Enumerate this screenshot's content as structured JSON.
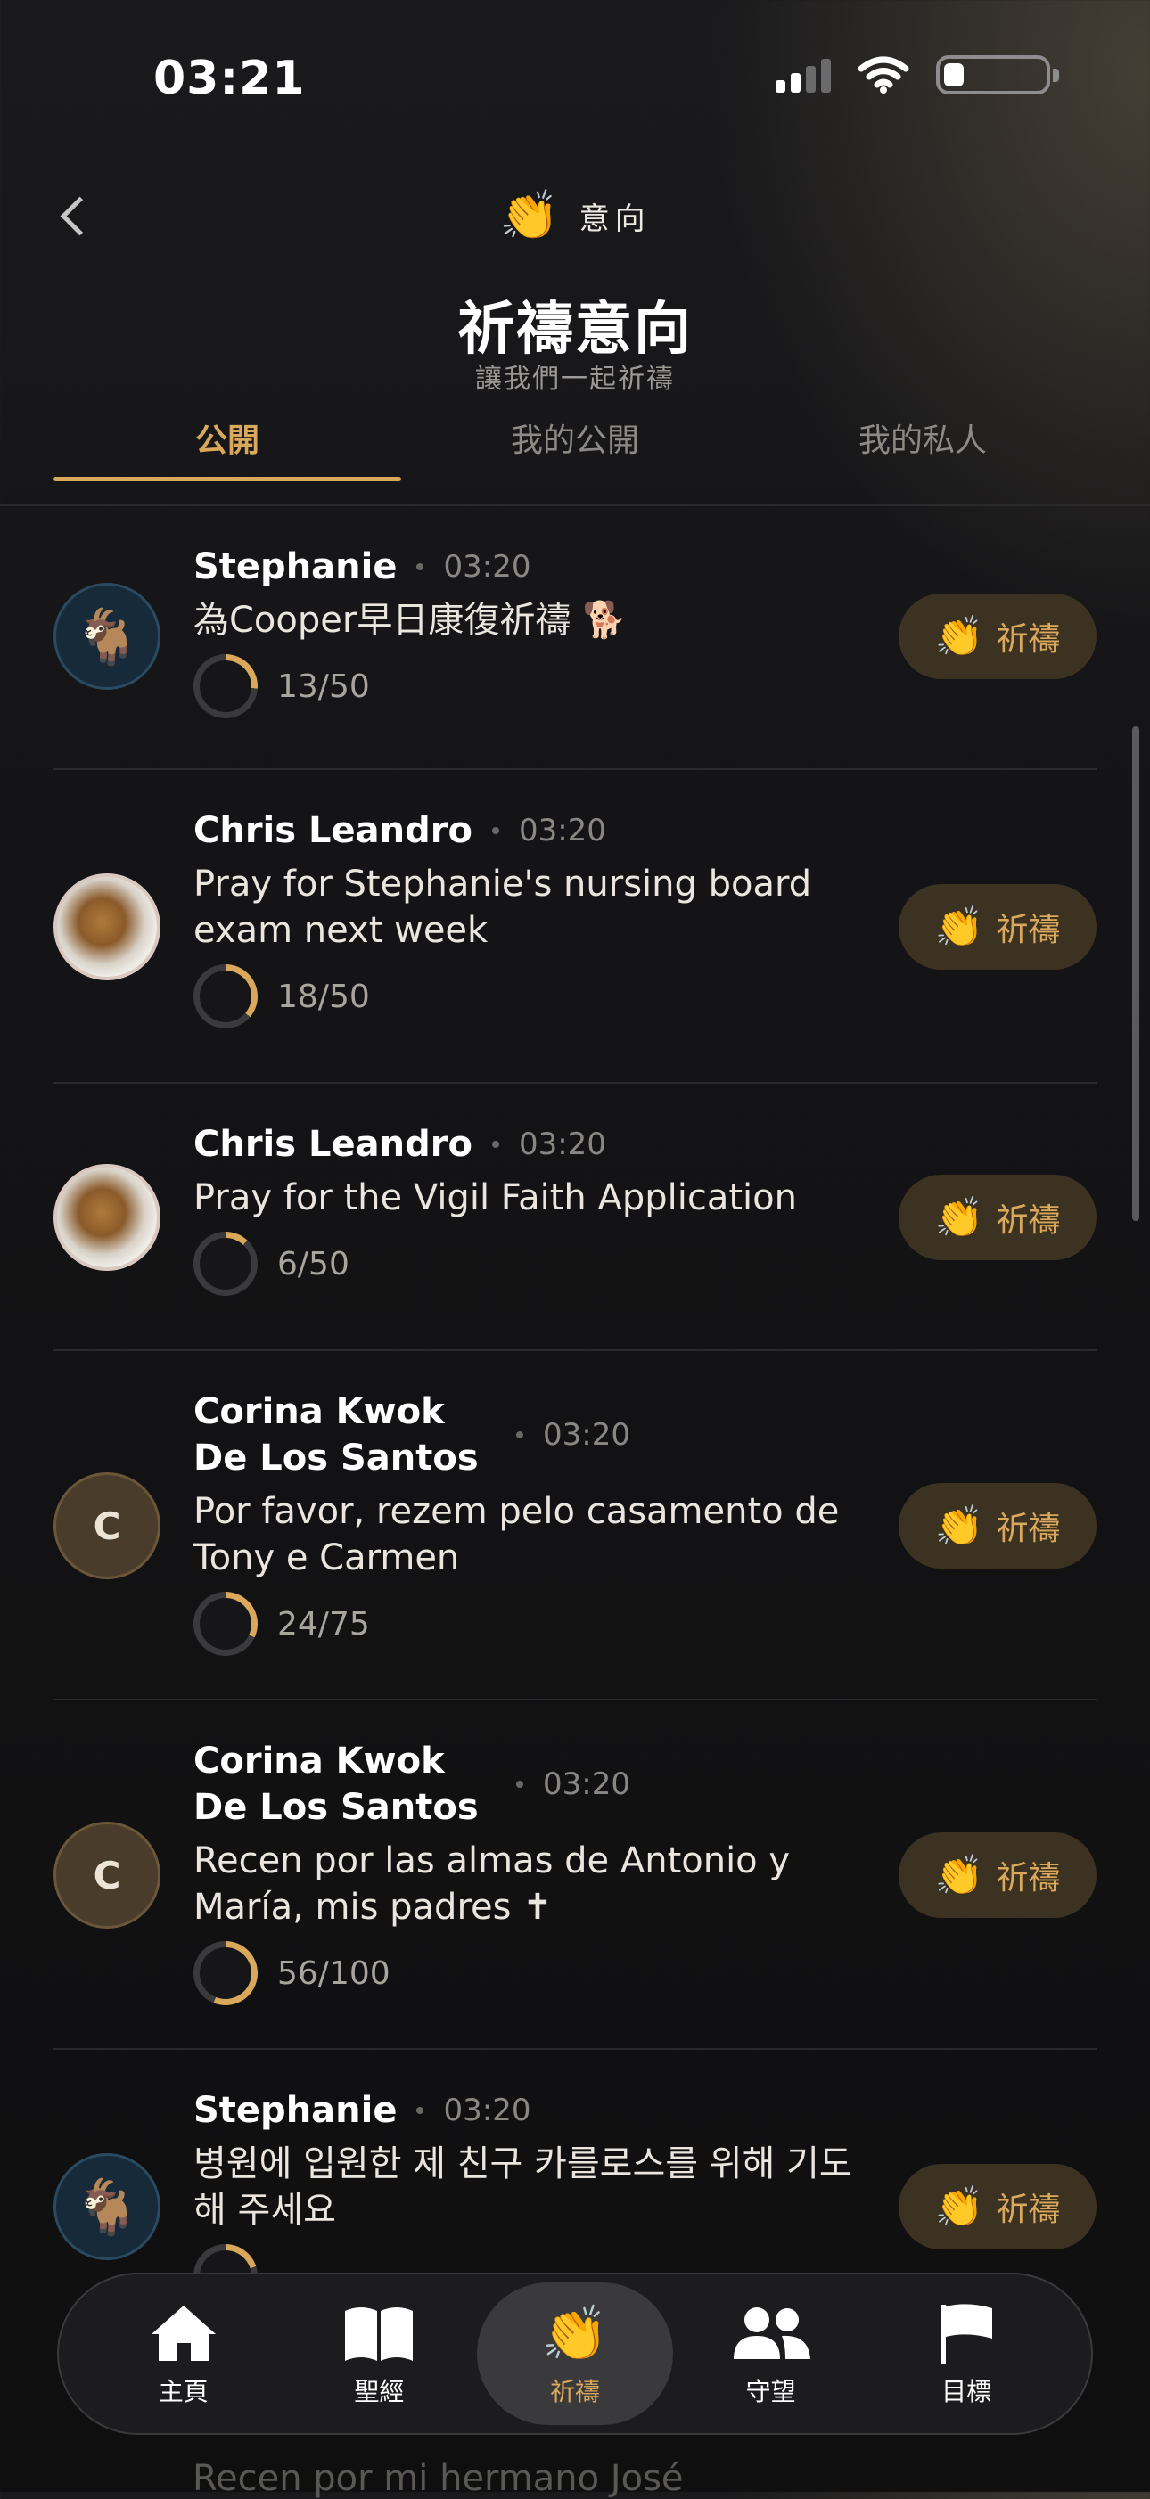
{
  "status": {
    "time": "03:21"
  },
  "header": {
    "back_icon": "chevron-left-icon",
    "title_emoji": "👏",
    "title": "意向",
    "page_title": "祈禱意向",
    "page_subtitle": "讓我們一起祈禱"
  },
  "tabs": [
    {
      "label": "公開",
      "active": true
    },
    {
      "label": "我的公開",
      "active": false
    },
    {
      "label": "我的私人",
      "active": false
    }
  ],
  "pray_label": "祈禱",
  "pray_icon": "👏",
  "colors": {
    "accent": "#d9a85b",
    "pray_button_bg": "#3b3222",
    "background": "#141416"
  },
  "feed": [
    {
      "author": "Stephanie",
      "time": "03:20",
      "text": "為Cooper早日康復祈禱 🐕",
      "count": "13/50",
      "progress": 0.26,
      "avatar": "goat-icon"
    },
    {
      "author": "Chris Leandro",
      "time": "03:20",
      "text": "Pray for Stephanie's nursing board exam next week",
      "count": "18/50",
      "progress": 0.36,
      "avatar": "food-photo"
    },
    {
      "author": "Chris Leandro",
      "time": "03:20",
      "text": "Pray for the Vigil Faith Application",
      "count": "6/50",
      "progress": 0.12,
      "avatar": "food-photo"
    },
    {
      "author": "Corina Kwok De Los Santos",
      "time": "03:20",
      "text": "Por favor, rezem pelo casamento de Tony e Carmen",
      "count": "24/75",
      "progress": 0.32,
      "avatar_letter": "C"
    },
    {
      "author": "Corina Kwok De Los Santos",
      "time": "03:20",
      "text": "Recen por las almas de Antonio y María, mis padres ✝",
      "count": "56/100",
      "progress": 0.56,
      "avatar_letter": "C"
    },
    {
      "author": "Stephanie",
      "time": "03:20",
      "text": "병원에 입원한 제 친구 카를로스를 위해 기도해 주세요",
      "count": "",
      "progress": 0.2,
      "avatar": "goat-icon"
    }
  ],
  "partial_row_text": "Recen por mi hermano José",
  "navbar": [
    {
      "label": "主頁",
      "icon": "home-icon",
      "active": false
    },
    {
      "label": "聖經",
      "icon": "book-icon",
      "active": false
    },
    {
      "label": "祈禱",
      "icon": "praying-hands-icon",
      "active": true
    },
    {
      "label": "守望",
      "icon": "people-icon",
      "active": false
    },
    {
      "label": "目標",
      "icon": "flag-icon",
      "active": false
    }
  ]
}
